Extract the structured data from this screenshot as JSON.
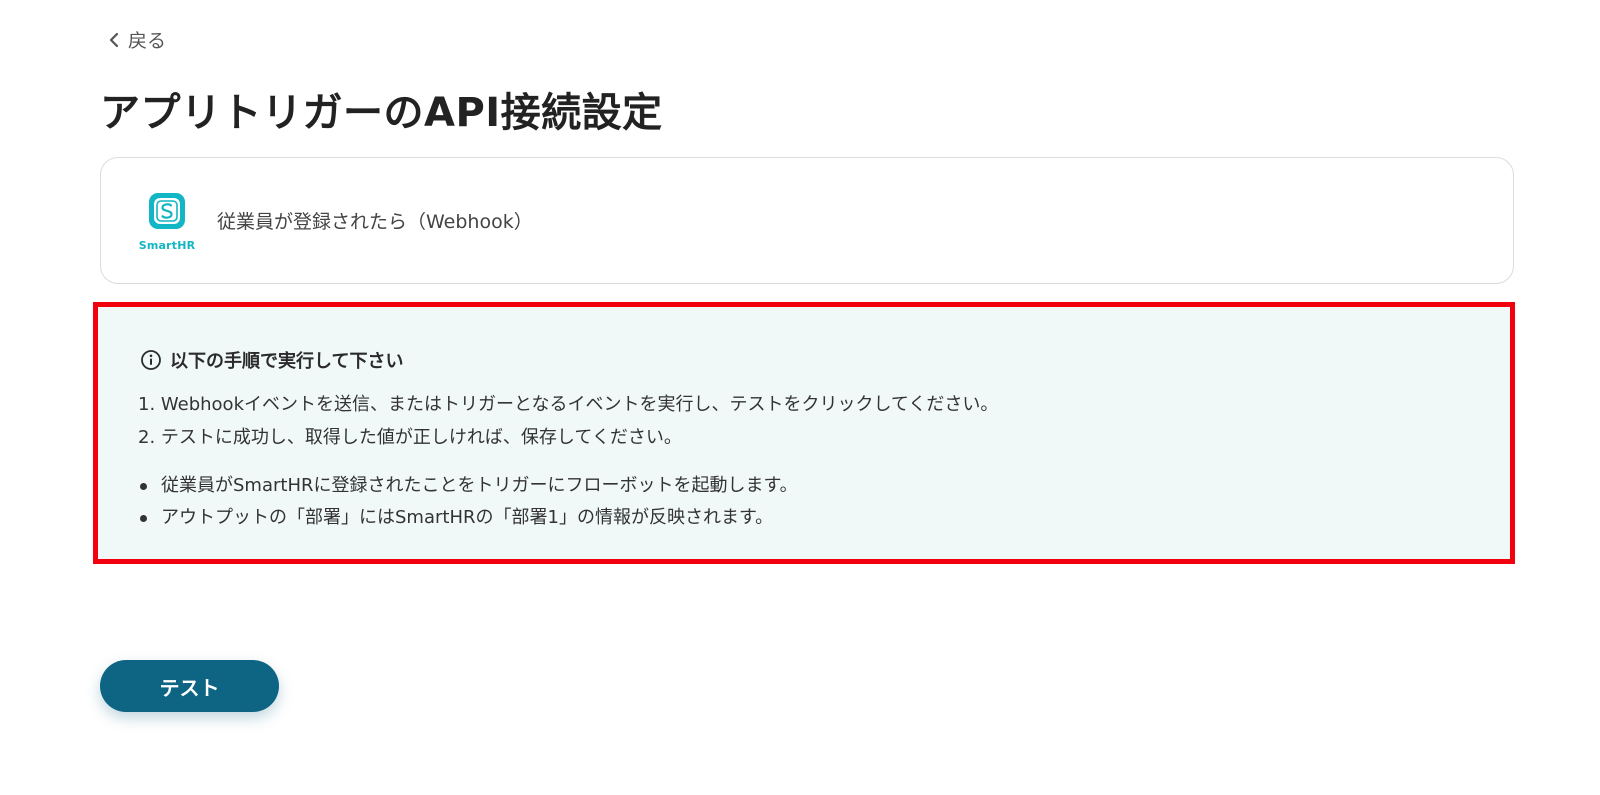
{
  "nav": {
    "back_label": "戻る"
  },
  "page": {
    "title": "アプリトリガーのAPI接続設定"
  },
  "trigger": {
    "app_name": "SmartHR",
    "app_color": "#12b6c4",
    "label": "従業員が登録されたら（Webhook）"
  },
  "instructions": {
    "heading": "以下の手順で実行して下さい",
    "highlight_color": "#f2000d",
    "steps": [
      "1. Webhookイベントを送信、またはトリガーとなるイベントを実行し、テストをクリックしてください。",
      "2. テストに成功し、取得した値が正しければ、保存してください。"
    ],
    "notes": [
      "従業員がSmartHRに登録されたことをトリガーにフローボットを起動します。",
      "アウトプットの「部署」にはSmartHRの「部署1」の情報が反映されます。"
    ]
  },
  "actions": {
    "test_label": "テスト",
    "test_color": "#0d6483"
  }
}
